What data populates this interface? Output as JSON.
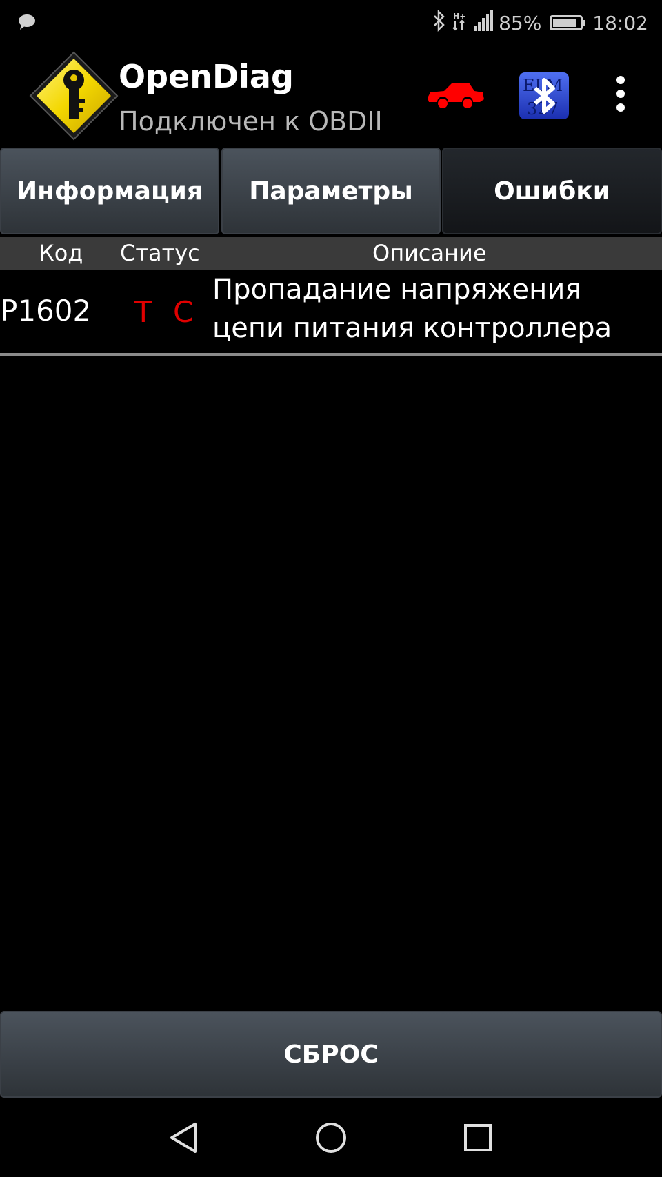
{
  "status_bar": {
    "battery": "85%",
    "battery_level": 0.85,
    "time": "18:02",
    "icons": [
      "message-icon",
      "bluetooth-icon",
      "network-type-icon",
      "signal-icon",
      "battery-icon"
    ]
  },
  "action_bar": {
    "title": "OpenDiag",
    "subtitle": "Подключен к OBDII",
    "icons": [
      "app-logo-icon",
      "car-icon",
      "elm327-bluetooth-icon",
      "overflow-menu-icon"
    ],
    "car_color": "#ff0000"
  },
  "tabs": [
    {
      "label": "Информация",
      "active": false
    },
    {
      "label": "Параметры",
      "active": false
    },
    {
      "label": "Ошибки",
      "active": true
    }
  ],
  "table": {
    "headers": {
      "code": "Код",
      "status": "Статус",
      "description": "Описание"
    },
    "rows": [
      {
        "code": "P1602",
        "status": [
          "T",
          "C"
        ],
        "description_lines": [
          "Пропадание напряжения",
          "цепи питания контроллера"
        ]
      }
    ],
    "status_color": "#e00000"
  },
  "reset_button": {
    "label": "СБРОС"
  },
  "nav_bar": {
    "icons": [
      "back-icon",
      "home-icon",
      "recent-apps-icon"
    ]
  }
}
